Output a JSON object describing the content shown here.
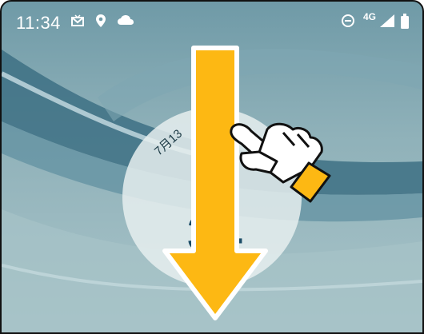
{
  "status_bar": {
    "time": "11:34",
    "network": "4G",
    "icons": [
      "mail-icon",
      "location-pin-icon",
      "cloud-icon",
      "do-not-disturb-icon",
      "signal-icon",
      "battery-icon"
    ]
  },
  "lock_clock": {
    "date": "7月13",
    "digits": "34"
  },
  "gesture_hint": {
    "arrow_icon": "down-arrow-icon",
    "hand_icon": "pointing-hand-icon",
    "arrow_color": "#FDB813",
    "hand_sleeve_color": "#FDB813"
  },
  "colors": {
    "status_text": "#FFFFFF",
    "clock_digits": "#1B4C66",
    "wallpaper": "#8FB1B9"
  }
}
